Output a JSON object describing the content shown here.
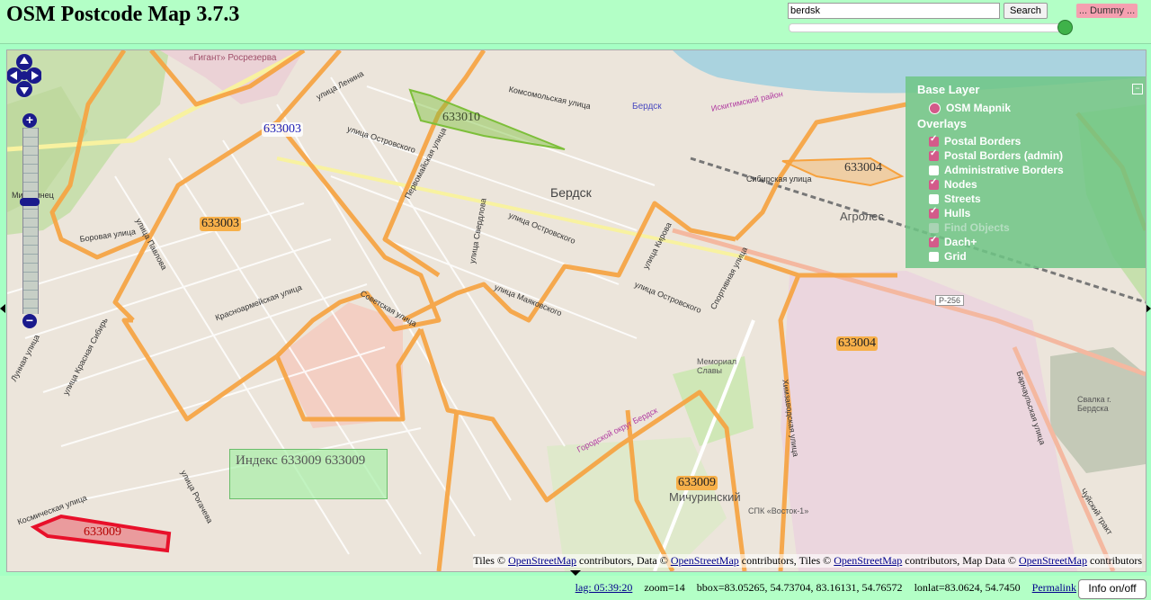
{
  "app": {
    "title": "OSM Postcode Map 3.7.3"
  },
  "search": {
    "value": "berdsk",
    "button_label": "Search",
    "dummy_label": "... Dummy ..."
  },
  "map": {
    "postcodes": [
      {
        "code": "633003"
      },
      {
        "code": "633003"
      },
      {
        "code": "633010"
      },
      {
        "code": "633004"
      },
      {
        "code": "633004"
      },
      {
        "code": "633009"
      },
      {
        "code": "633009"
      }
    ],
    "places": [
      "Бердск",
      "Агролес",
      "Мичуринский",
      "Мемориал Славы",
      "«Гигант» Росрезерва",
      "Бердск",
      "Свалка г. Бердска",
      "СПК «Восток-1»",
      "Р-256",
      "Городской округ Бердск",
      "Искитимский район",
      "Мичуринец"
    ],
    "streets": [
      "Комсомольская улица",
      "улица Ленина",
      "улица Островского",
      "Первомайская улица",
      "Сибирская улица",
      "улица Свердлова",
      "улица Островского",
      "улица Кирова",
      "улица Маяковского",
      "Советская улица",
      "Красноармейская улица",
      "улица Красная Сибирь",
      "Боровая улица",
      "Лунная улица",
      "Космическая улица",
      "улица Рогачева",
      "Химзаводская улица",
      "Барнаульская улица",
      "Чуйский тракт",
      "Спортивная улица",
      "улица Островского",
      "улица Павлова"
    ],
    "info_box": "Индекс 633009 633009",
    "colors": {
      "postal_border": "#f7a23e",
      "hull_green": "#7dbf3a",
      "hull_red": "#e8102a",
      "panel": "#6ec685"
    }
  },
  "layers": {
    "base_title": "Base Layer",
    "base_option": "OSM Mapnik",
    "overlays_title": "Overlays",
    "overlays": [
      {
        "label": "Postal Borders",
        "checked": true
      },
      {
        "label": "Postal Borders (admin)",
        "checked": true
      },
      {
        "label": "Administrative Borders",
        "checked": false
      },
      {
        "label": "Nodes",
        "checked": true
      },
      {
        "label": "Streets",
        "checked": false
      },
      {
        "label": "Hulls",
        "checked": true
      },
      {
        "label": "Find Objects",
        "checked": false,
        "disabled": true
      },
      {
        "label": "Dach+",
        "checked": true
      },
      {
        "label": "Grid",
        "checked": false
      }
    ],
    "minimize": "−"
  },
  "attribution": {
    "p1": "Tiles © ",
    "link1": "OpenStreetMap",
    "p2": " contributors, Data © ",
    "link2": "OpenStreetMap",
    "p3": " contributors, Tiles © ",
    "link3": "OpenStreetMap",
    "p4": " contributors, Map Data © ",
    "link4": "OpenStreetMap",
    "p5": " contributors"
  },
  "footer": {
    "lag": "lag: 05:39:20",
    "zoom": "zoom=14",
    "bbox": "bbox=83.05265, 54.73704, 83.16131, 54.76572",
    "lonlat": "lonlat=83.0624, 54.7450",
    "permalink": "Permalink",
    "info_toggle": "Info on/off"
  }
}
